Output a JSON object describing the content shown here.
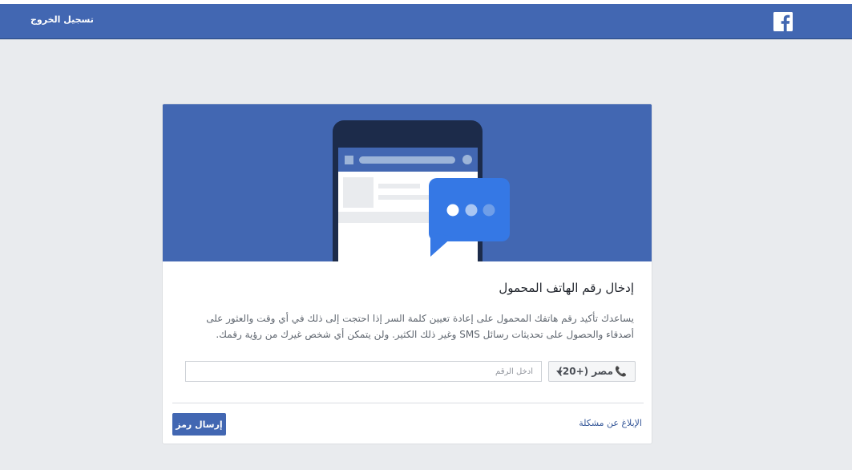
{
  "header": {
    "logout_label": "تسجيل الخروج",
    "logo_icon": "facebook-logo-icon"
  },
  "card": {
    "title": "إدخال رقم الهاتف المحمول",
    "description": "يساعدك تأكيد رقم هاتفك المحمول على إعادة تعيين كلمة السر إذا احتجت إلى ذلك في أي وقت والعثور على أصدقاء والحصول على تحديثات رسائل SMS وغير ذلك الكثير. ولن يتمكن أي شخص غيرك من رؤية رقمك.",
    "country_selector": {
      "label": "مصر (+20)",
      "icon": "phone-icon"
    },
    "phone_input": {
      "value": "",
      "placeholder": "أدخل الرقم"
    },
    "report_link": "الإبلاغ عن مشكلة",
    "send_button": "إرسال رمز"
  },
  "colors": {
    "brand": "#4267b2",
    "background": "#e9ebee",
    "chat_bubble": "#3578e5"
  }
}
